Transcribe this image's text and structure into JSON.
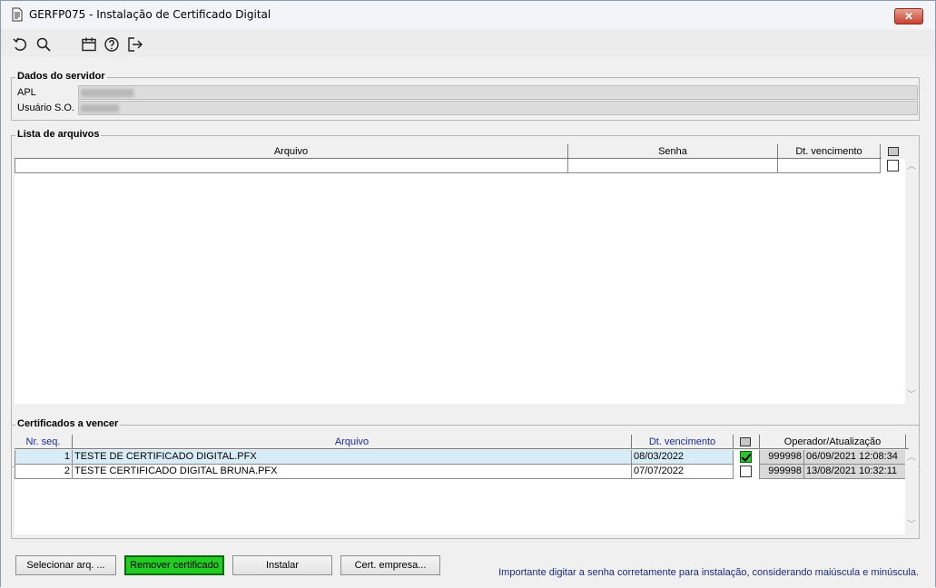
{
  "window": {
    "title": "GERFP075 - Instalação de Certificado Digital",
    "close_label": "✕"
  },
  "toolbar": {
    "icons": [
      "undo-icon",
      "search-icon",
      "calendar-icon",
      "help-icon",
      "exit-icon"
    ]
  },
  "server": {
    "legend": "Dados do servidor",
    "apl_label": "APL",
    "user_label": "Usuário S.O."
  },
  "files": {
    "legend": "Lista de arquivos",
    "columns": [
      "Arquivo",
      "Senha",
      "Dt. vencimento"
    ]
  },
  "expiring": {
    "legend": "Certificados a vencer",
    "columns": [
      "Nr. seq.",
      "Arquivo",
      "Dt. vencimento",
      "Operador/Atualização"
    ],
    "rows": [
      {
        "seq": "1",
        "file": "TESTE DE CERTIFICADO DIGITAL.PFX",
        "date": "08/03/2022",
        "checked": true,
        "operator": "999998",
        "updated": "06/09/2021 12:08:34"
      },
      {
        "seq": "2",
        "file": "TESTE CERTIFICADO DIGITAL BRUNA.PFX",
        "date": "07/07/2022",
        "checked": false,
        "operator": "999998",
        "updated": "13/08/2021 10:32:11"
      }
    ]
  },
  "buttons": {
    "select": "Selecionar arq. ...",
    "remove": "Remover certificado",
    "install": "Instalar",
    "company": "Cert. empresa..."
  },
  "hint": "Importante digitar a senha corretamente para instalação, considerando maiúscula e minúscula.",
  "colors": {
    "accent_green": "#22cc22",
    "selected_row": "#d8ecf7",
    "header_blue": "#1a2a9a"
  }
}
